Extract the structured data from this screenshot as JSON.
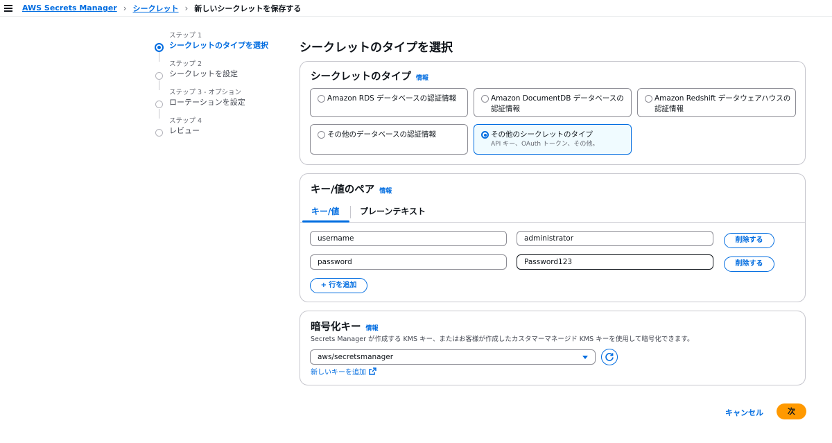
{
  "breadcrumb": {
    "items": [
      "AWS Secrets Manager",
      "シークレット"
    ],
    "current": "新しいシークレットを保存する"
  },
  "steps": [
    {
      "num": "ステップ 1",
      "label": "シークレットのタイプを選択",
      "active": true
    },
    {
      "num": "ステップ 2",
      "label": "シークレットを設定",
      "active": false
    },
    {
      "num": "ステップ 3 - オプション",
      "label": "ローテーションを設定",
      "active": false
    },
    {
      "num": "ステップ 4",
      "label": "レビュー",
      "active": false
    }
  ],
  "page_title": "シークレットのタイプを選択",
  "secret_type": {
    "title": "シークレットのタイプ",
    "info": "情報",
    "options": [
      {
        "label": "Amazon RDS データベースの認証情報",
        "selected": false
      },
      {
        "label": "Amazon DocumentDB データベースの認証情報",
        "selected": false
      },
      {
        "label": "Amazon Redshift データウェアハウスの認証情報",
        "selected": false
      },
      {
        "label": "その他のデータベースの認証情報",
        "selected": false
      },
      {
        "label": "その他のシークレットのタイプ",
        "desc": "API キー、OAuth トークン、その他。",
        "selected": true
      }
    ]
  },
  "kv": {
    "title": "キー/値のペア",
    "info": "情報",
    "tabs": [
      "キー/値",
      "プレーンテキスト"
    ],
    "rows": [
      {
        "key": "username",
        "value": "administrator"
      },
      {
        "key": "password",
        "value": "Password123"
      }
    ],
    "remove_label": "削除する",
    "add_row_label": "+ 行を追加"
  },
  "encryption": {
    "title": "暗号化キー",
    "info": "情報",
    "desc": "Secrets Manager が作成する KMS キー、またはお客様が作成したカスタマーマネージド KMS キーを使用して暗号化できます。",
    "selected_key": "aws/secretsmanager",
    "new_key_link": "新しいキーを追加"
  },
  "footer": {
    "cancel": "キャンセル",
    "next": "次"
  },
  "colors": {
    "accent": "#006ce0",
    "primary_button": "#ff9900",
    "border": "#c6c6cd"
  }
}
